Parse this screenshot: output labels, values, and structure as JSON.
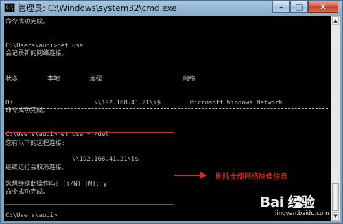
{
  "window": {
    "title": "管理员: C:\\Windows\\system32\\cmd.exe",
    "icon_text": "C:\\"
  },
  "controls": {
    "minimize_icon": "minimize-icon",
    "maximize_icon": "maximize-icon",
    "close_icon": "close-icon",
    "minimize": "–",
    "maximize": "□",
    "close": "✕"
  },
  "console": {
    "lines": [
      "命令成功完成。",
      "C:\\Users\\audi>net use",
      "会记录新的网络连接。",
      "状态        本地        远程                      网络",
      "OK                      \\\\192.168.41.21\\i$        Microsoft Windows Network",
      "命令成功完成。",
      "C:\\Users\\audi>net use * /del",
      "您有以下的远程连接:",
      "                  \\\\192.168.41.21\\i$",
      "继续运行会取消连接。",
      "您想继续此操作吗? (Y/N) [N]: y",
      "命令成功完成。",
      "C:\\Users\\audi>"
    ]
  },
  "annotation": {
    "text": "删除全部网络映像信息",
    "color": "#ff2d24"
  },
  "watermark": {
    "brand": "Bai 经验",
    "site": "jingyan.baidu.com"
  },
  "colors": {
    "console_background": "#000000",
    "console_text": "#c0c0c0",
    "highlight_box": "#d72a24"
  }
}
